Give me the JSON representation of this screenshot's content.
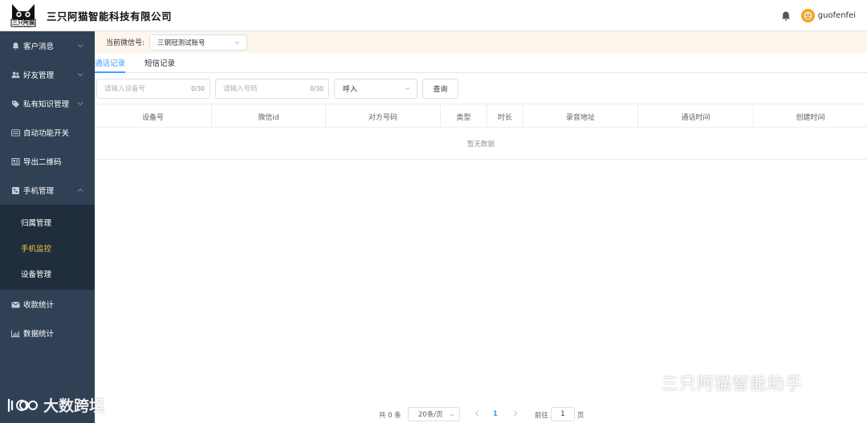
{
  "header": {
    "brand": "三只阿猫智能科技有限公司",
    "logo_text": "三只阿猫",
    "logo_subtext": "3MAMAO.COM",
    "username": "guofenfei"
  },
  "sidebar": {
    "items": [
      {
        "label": "客户消息",
        "icon": "bell-icon"
      },
      {
        "label": "好友管理",
        "icon": "users-icon"
      },
      {
        "label": "私有知识管理",
        "icon": "tag-icon"
      },
      {
        "label": "自动功能开关",
        "icon": "switch-icon"
      },
      {
        "label": "导出二维码",
        "icon": "qrcode-icon"
      },
      {
        "label": "手机管理",
        "icon": "phone-icon"
      }
    ],
    "submenu": [
      {
        "label": "归属管理",
        "active": false
      },
      {
        "label": "手机监控",
        "active": true
      },
      {
        "label": "设备管理",
        "active": false
      }
    ],
    "bottom_items": [
      {
        "label": "收款统计",
        "icon": "mail-icon"
      },
      {
        "label": "数据统计",
        "icon": "chart-icon"
      }
    ]
  },
  "account": {
    "label": "当前微信号:",
    "value": "三钢冠测试账号"
  },
  "tabs": [
    {
      "label": "通话记录",
      "active": true
    },
    {
      "label": "短信记录",
      "active": false
    }
  ],
  "filters": {
    "device_placeholder": "请输入设备号",
    "device_count": "0/30",
    "number_placeholder": "请输入号码",
    "number_count": "0/30",
    "direction_value": "呼入",
    "search_label": "查询"
  },
  "table": {
    "columns": [
      "设备号",
      "微信id",
      "对方号码",
      "类型",
      "时长",
      "录音地址",
      "通话时间",
      "创建时间"
    ],
    "empty_text": "暂无数据"
  },
  "pagination": {
    "total": "共 0 条",
    "page_size": "20条/页",
    "current_page": "1",
    "goto_label": "前往",
    "goto_value": "1",
    "page_unit": "页"
  },
  "watermarks": {
    "right": "三只阿猫智能助手",
    "left": "大数跨境"
  },
  "colors": {
    "sidebar_bg": "#304156",
    "submenu_bg": "#1f2d3d",
    "active_menu": "#f7c242",
    "accent": "#409eff",
    "account_bar_bg": "#fdf6ec"
  }
}
